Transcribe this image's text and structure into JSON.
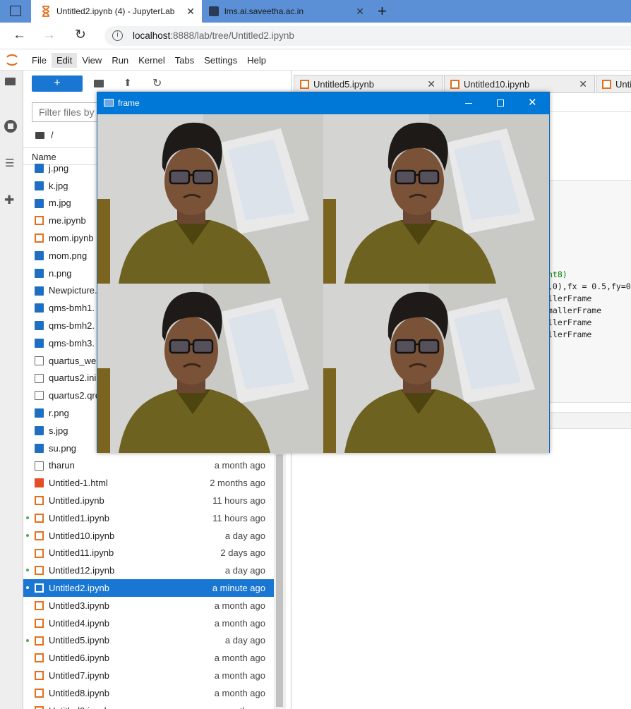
{
  "browser": {
    "tabs": [
      {
        "title": "Untitled2.ipynb (4) - JupyterLab",
        "active": true
      },
      {
        "title": "lms.ai.saveetha.ac.in",
        "active": false
      }
    ],
    "url_host": "localhost",
    "url_rest": ":8888/lab/tree/Untitled2.ipynb"
  },
  "jupyter": {
    "menu": [
      "File",
      "Edit",
      "View",
      "Run",
      "Kernel",
      "Tabs",
      "Settings",
      "Help"
    ],
    "filter_placeholder": "Filter files by",
    "path": "/",
    "column_name": "Name",
    "files": [
      {
        "name": "j.png",
        "type": "image",
        "modified": "",
        "dot": false
      },
      {
        "name": "k.jpg",
        "type": "image",
        "modified": "",
        "dot": false
      },
      {
        "name": "m.jpg",
        "type": "image",
        "modified": "",
        "dot": false
      },
      {
        "name": "me.ipynb",
        "type": "notebook",
        "modified": "",
        "dot": false
      },
      {
        "name": "mom.ipynb",
        "type": "notebook",
        "modified": "",
        "dot": false
      },
      {
        "name": "mom.png",
        "type": "image",
        "modified": "",
        "dot": false
      },
      {
        "name": "n.png",
        "type": "image",
        "modified": "",
        "dot": false
      },
      {
        "name": "Newpicture.",
        "type": "image",
        "modified": "",
        "dot": false
      },
      {
        "name": "qms-bmh1.",
        "type": "image",
        "modified": "",
        "dot": false
      },
      {
        "name": "qms-bmh2.",
        "type": "image",
        "modified": "",
        "dot": false
      },
      {
        "name": "qms-bmh3.",
        "type": "image",
        "modified": "",
        "dot": false
      },
      {
        "name": "quartus_we",
        "type": "text",
        "modified": "",
        "dot": false
      },
      {
        "name": "quartus2.ini",
        "type": "text",
        "modified": "",
        "dot": false
      },
      {
        "name": "quartus2.qre",
        "type": "text",
        "modified": "",
        "dot": false
      },
      {
        "name": "r.png",
        "type": "image",
        "modified": "",
        "dot": false
      },
      {
        "name": "s.jpg",
        "type": "image",
        "modified": "",
        "dot": false
      },
      {
        "name": "su.png",
        "type": "image",
        "modified": "",
        "dot": false
      },
      {
        "name": "tharun",
        "type": "text",
        "modified": "a month ago",
        "dot": false
      },
      {
        "name": "Untitled-1.html",
        "type": "html",
        "modified": "2 months ago",
        "dot": false
      },
      {
        "name": "Untitled.ipynb",
        "type": "notebook",
        "modified": "11 hours ago",
        "dot": false
      },
      {
        "name": "Untitled1.ipynb",
        "type": "notebook",
        "modified": "11 hours ago",
        "dot": true
      },
      {
        "name": "Untitled10.ipynb",
        "type": "notebook",
        "modified": "a day ago",
        "dot": true
      },
      {
        "name": "Untitled11.ipynb",
        "type": "notebook",
        "modified": "2 days ago",
        "dot": false
      },
      {
        "name": "Untitled12.ipynb",
        "type": "notebook",
        "modified": "a day ago",
        "dot": true
      },
      {
        "name": "Untitled2.ipynb",
        "type": "notebook",
        "modified": "a minute ago",
        "dot": true,
        "selected": true
      },
      {
        "name": "Untitled3.ipynb",
        "type": "notebook",
        "modified": "a month ago",
        "dot": false
      },
      {
        "name": "Untitled4.ipynb",
        "type": "notebook",
        "modified": "a month ago",
        "dot": false
      },
      {
        "name": "Untitled5.ipynb",
        "type": "notebook",
        "modified": "a day ago",
        "dot": true
      },
      {
        "name": "Untitled6.ipynb",
        "type": "notebook",
        "modified": "a month ago",
        "dot": false
      },
      {
        "name": "Untitled7.ipynb",
        "type": "notebook",
        "modified": "a month ago",
        "dot": false
      },
      {
        "name": "Untitled8.ipynb",
        "type": "notebook",
        "modified": "a month ago",
        "dot": false
      },
      {
        "name": "Untitled9.ipynb",
        "type": "notebook",
        "modified": "a month ago",
        "dot": false
      }
    ],
    "doc_tabs": [
      "Untitled5.ipynb",
      "Untitled10.ipynb",
      "Unti"
    ],
    "code_lines": [
      "nt8)",
      ",0),fx = 0.5,fy=0",
      "llerFrame",
      "mallerFrame",
      "llerFrame",
      "llerFrame"
    ]
  },
  "cv_window": {
    "title": "frame"
  }
}
